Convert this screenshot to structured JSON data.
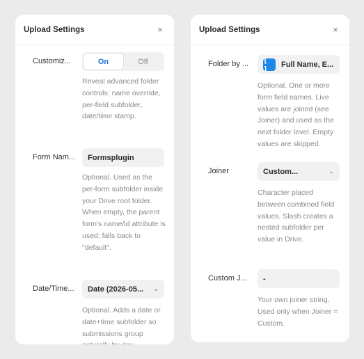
{
  "left_panel": {
    "title": "Upload Settings",
    "close_glyph": "×",
    "customize": {
      "label": "Customiz...",
      "on_label": "On",
      "off_label": "Off",
      "help": "Reveal advanced folder controls: name override, per-field subfolder, date/time stamp."
    },
    "form_name": {
      "label": "Form Nam...",
      "value": "Formsplugin",
      "help": "Optional. Used as the per-form subfolder inside your Drive root folder. When empty, the parent form's name/id attribute is used; falls back to \"default\"."
    },
    "date_time": {
      "label": "Date/Time...",
      "value": "Date (2026-05...",
      "help": "Optional. Adds a date or date+time subfolder so submissions group naturally by day."
    }
  },
  "right_panel": {
    "title": "Upload Settings",
    "close_glyph": "×",
    "folder_by": {
      "label": "Folder by ...",
      "icon_glyph": "[ ]",
      "value": "Full Name, E...",
      "help": "Optional. One or more form field names. Live values are joined (see Joiner) and used as the next folder level. Empty values are skipped."
    },
    "joiner": {
      "label": "Joiner",
      "value": "Custom...",
      "help": "Character placed between combined field values. Slash creates a nested subfolder per value in Drive."
    },
    "custom_joiner": {
      "label": "Custom J...",
      "value": "-",
      "help": "Your own joiner string. Used only when Joiner = Custom."
    }
  },
  "colors": {
    "accent": "#1f6fd6",
    "chip": "#1e88e5",
    "background": "#ebebeb",
    "panel": "#ffffff"
  }
}
